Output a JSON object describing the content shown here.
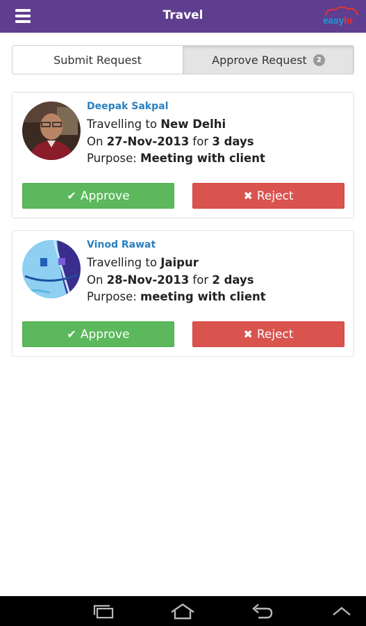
{
  "header": {
    "title": "Travel",
    "logo_part1": "easy",
    "logo_part2": "hr"
  },
  "tabs": [
    {
      "label": "Submit Request",
      "active": false
    },
    {
      "label": "Approve Request",
      "active": true,
      "badge": "2"
    }
  ],
  "requests": [
    {
      "name": "Deepak Sakpal",
      "prefix_travel": "Travelling to ",
      "destination": "New Delhi",
      "prefix_on": "On ",
      "date": "27-Nov-2013",
      "prefix_for": " for ",
      "duration": "3 days",
      "prefix_purpose": "Purpose: ",
      "purpose": "Meeting with client",
      "approve_label": "Approve",
      "reject_label": "Reject"
    },
    {
      "name": "Vinod Rawat",
      "prefix_travel": "Travelling to ",
      "destination": "Jaipur",
      "prefix_on": "On ",
      "date": "28-Nov-2013",
      "prefix_for": " for ",
      "duration": "2 days",
      "prefix_purpose": "Purpose: ",
      "purpose": "meeting with client",
      "approve_label": "Approve",
      "reject_label": "Reject"
    }
  ],
  "icons": {
    "approve": "check-icon",
    "reject": "times-icon",
    "menu": "hamburger-menu-icon"
  },
  "colors": {
    "header_bg": "#5f3e8f",
    "approve": "#5cb85c",
    "reject": "#d9534f",
    "name": "#2a7fbf"
  }
}
